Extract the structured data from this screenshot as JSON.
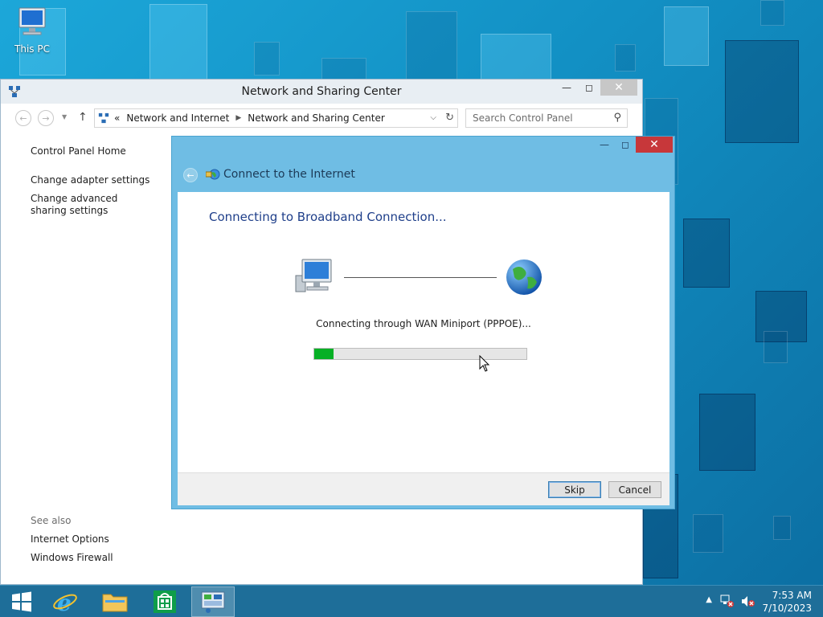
{
  "desktop": {
    "icon_label": "This PC"
  },
  "nsc_window": {
    "title": "Network and Sharing Center",
    "address": {
      "prefix": "«",
      "crumbs": [
        "Network and Internet",
        "Network and Sharing Center"
      ]
    },
    "search_placeholder": "Search Control Panel",
    "left_links": [
      "Control Panel Home",
      "Change adapter settings",
      "Change advanced sharing settings"
    ],
    "see_also_heading": "See also",
    "see_also_links": [
      "Internet Options",
      "Windows Firewall"
    ]
  },
  "dialog": {
    "title": "Connect to the Internet",
    "heading": "Connecting to Broadband Connection...",
    "status": "Connecting through WAN Miniport (PPPOE)...",
    "progress_percent": 9,
    "buttons": {
      "skip": "Skip",
      "cancel": "Cancel"
    }
  },
  "taskbar": {
    "clock_time": "7:53 AM",
    "clock_date": "7/10/2023"
  },
  "colors": {
    "dialog_frame": "#6fbde4",
    "progress_fill": "#06b025",
    "close_red": "#c7373a",
    "heading_blue": "#1f3f8a"
  }
}
